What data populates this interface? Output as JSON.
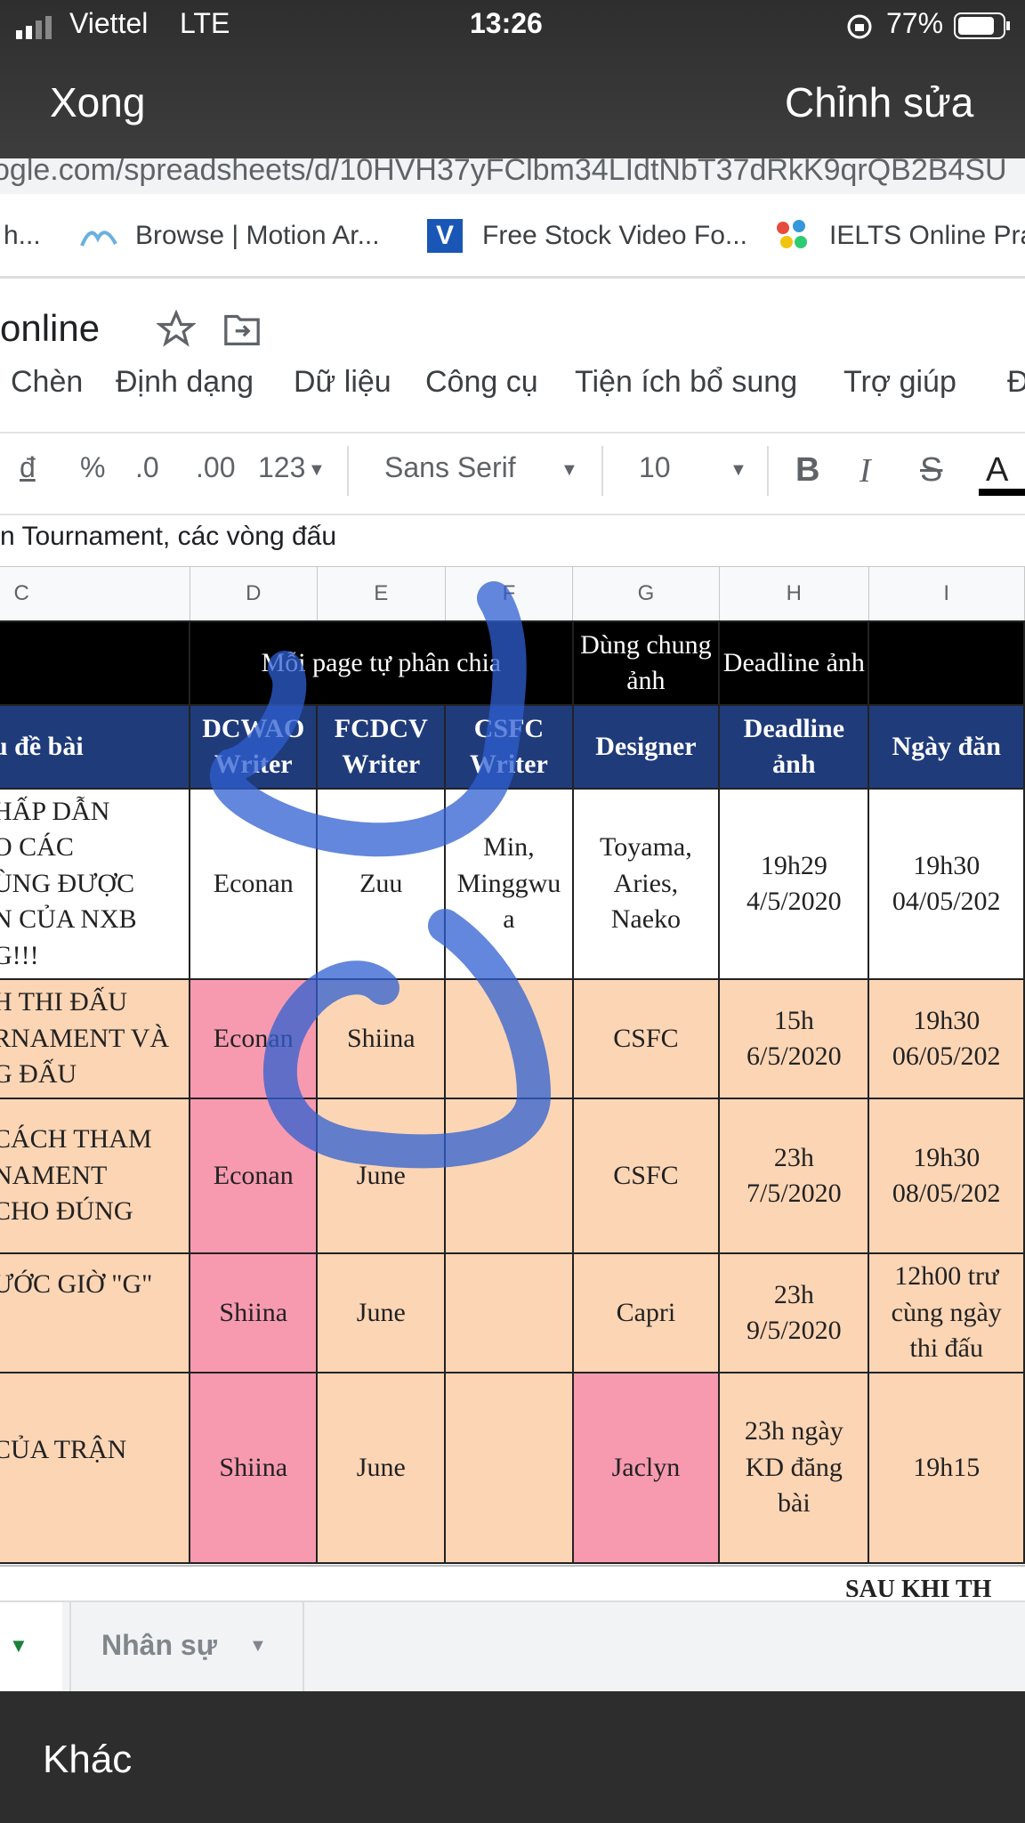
{
  "status": {
    "carrier": "Viettel",
    "network": "LTE",
    "time": "13:26",
    "battery": "77%"
  },
  "nav": {
    "done": "Xong",
    "edit": "Chỉnh sửa"
  },
  "browser": {
    "url": "ogle.com/spreadsheets/d/10HVH37yFClbm34LIdtNbT37dRkK9qrQB2B4SU",
    "bookmarks": [
      "h...",
      "Browse | Motion Ar...",
      "Free Stock Video Fo...",
      "IELTS Online Prac"
    ]
  },
  "sheet": {
    "title": "online",
    "menu": [
      "Chèn",
      "Định dạng",
      "Dữ liệu",
      "Công cụ",
      "Tiện ích bổ sung",
      "Trợ giúp",
      "Đ"
    ],
    "toolbar": {
      "currency": "đ",
      "percent": "%",
      "dec_decrease": ".0",
      "dec_increase": ".00",
      "format": "123",
      "font": "Sans Serif",
      "size": "10",
      "bold": "B",
      "italic": "I",
      "strike": "S",
      "text_color": "A"
    },
    "formula": "n Tournament, các vòng đấu",
    "columns": [
      "C",
      "D",
      "E",
      "F",
      "G",
      "H",
      "I"
    ],
    "header1": {
      "group": "Mỗi page tự phân chia",
      "g": "Dùng chung ảnh",
      "h": "Deadline ảnh"
    },
    "header2": [
      "u đề bài",
      "DCWAO Writer",
      "FCDCV Writer",
      "CSFC Writer",
      "Designer",
      "Deadline ảnh",
      "Ngày đăn"
    ],
    "rows": [
      {
        "c": "HẤP DẪN\nO CÁC\nÙNG ĐƯỢC\nN CỦA NXB\nG!!!",
        "d": "Econan",
        "e": "Zuu",
        "f": "Min,\nMinggwu\na",
        "g": "Toyama,\nAries,\nNaeko",
        "h": "19h29\n4/5/2020",
        "i": "19h30\n04/05/202"
      },
      {
        "c": "H THI ĐẤU\nRNAMENT VÀ\nG ĐẤU",
        "d": "Econan",
        "e": "Shiina",
        "f": "",
        "g": "CSFC",
        "h": "15h\n6/5/2020",
        "i": "19h30\n06/05/202"
      },
      {
        "c": "CÁCH THAM\nNAMENT\nCHO ĐÚNG",
        "d": "Econan",
        "e": "June",
        "f": "",
        "g": "CSFC",
        "h": "23h\n7/5/2020",
        "i": "19h30\n08/05/202"
      },
      {
        "c": "ƯỚC GIỜ \"G\"",
        "d": "Shiina",
        "e": "June",
        "f": "",
        "g": "Capri",
        "h": "23h\n9/5/2020",
        "i": "12h00 trư\ncùng ngày\nthi đấu"
      },
      {
        "c": "CỦA TRẬN",
        "d": "Shiina",
        "e": "June",
        "f": "",
        "g": "Jaclyn",
        "h": "23h ngày\nKD đăng\nbài",
        "i": "19h15"
      }
    ],
    "footer_text": "SAU KHI TH",
    "tabs": {
      "nhansu": "Nhân sự"
    }
  },
  "bottom": {
    "more": "Khác"
  },
  "colors": {
    "header_blue": "#1f3b7a",
    "peach": "#fcd5b5",
    "pink": "#f79ab0",
    "scribble": "#2f5fd0"
  }
}
